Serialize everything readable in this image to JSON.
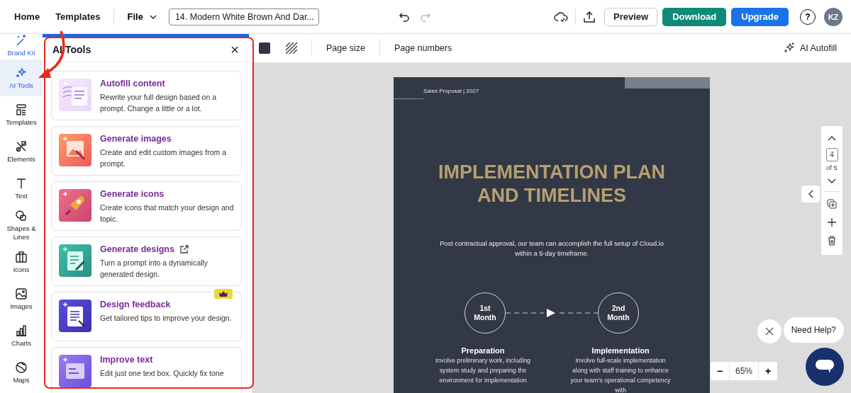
{
  "top_bar": {
    "nav": [
      "Home",
      "Templates"
    ],
    "file_menu": "File",
    "document_title": "14. Modern White Brown And Dar...",
    "preview": "Preview",
    "download": "Download",
    "upgrade": "Upgrade",
    "help": "?",
    "avatar": "KZ"
  },
  "sidebar": {
    "items": [
      {
        "label": "Brand Kit",
        "selected": false
      },
      {
        "label": "AI Tools",
        "selected": true
      },
      {
        "label": "Templates",
        "selected": false
      },
      {
        "label": "Elements",
        "selected": false
      },
      {
        "label": "Text",
        "selected": false
      },
      {
        "label": "Shapes & Lines",
        "selected": false
      },
      {
        "label": "Icons",
        "selected": false
      },
      {
        "label": "Images",
        "selected": false
      },
      {
        "label": "Charts",
        "selected": false
      },
      {
        "label": "Maps",
        "selected": false
      }
    ]
  },
  "panel": {
    "title": "AI Tools",
    "close": "×",
    "tools": [
      {
        "title": "Autofill content",
        "description": "Rewrite your full design based on a prompt. Change a little or a lot.",
        "external": false,
        "premium": false
      },
      {
        "title": "Generate images",
        "description": "Create and edit custom images from a prompt.",
        "external": false,
        "premium": false
      },
      {
        "title": "Generate icons",
        "description": "Create icons that match your design and topic.",
        "external": false,
        "premium": false
      },
      {
        "title": "Generate designs",
        "description": "Turn a prompt into a dynamically generated design.",
        "external": true,
        "premium": false
      },
      {
        "title": "Design feedback",
        "description": "Get tailored tips to improve your design.",
        "external": false,
        "premium": true
      },
      {
        "title": "Improve text",
        "description": "Edit just one text box. Quickly fix tone",
        "external": false,
        "premium": false
      }
    ]
  },
  "toolbar": {
    "page_size": "Page size",
    "page_numbers": "Page numbers",
    "ai_autofill": "AI Autofill"
  },
  "page": {
    "header": "Sales Proposal | 2027",
    "title_lines": [
      "IMPLEMENTATION PLAN",
      "AND TIMELINES"
    ],
    "intro": "Post contractual approval, our team can accomplish the full setup of Cloud.io within a 5-day timeframe.",
    "steps": [
      {
        "badge_lines": [
          "1st",
          "Month"
        ],
        "heading": "Preparation",
        "description": "Involve preliminary work, including system study and preparing the environment for implementation"
      },
      {
        "badge_lines": [
          "2nd",
          "Month"
        ],
        "heading": "Implementation",
        "description": "Involve full-scale implementation along with staff training to enhance your team's operational competency with"
      }
    ]
  },
  "page_nav": {
    "current": "4",
    "total": "of 5"
  },
  "zoom": {
    "minus": "−",
    "value": "65%",
    "plus": "+"
  },
  "help": {
    "label": "Need Help?"
  }
}
